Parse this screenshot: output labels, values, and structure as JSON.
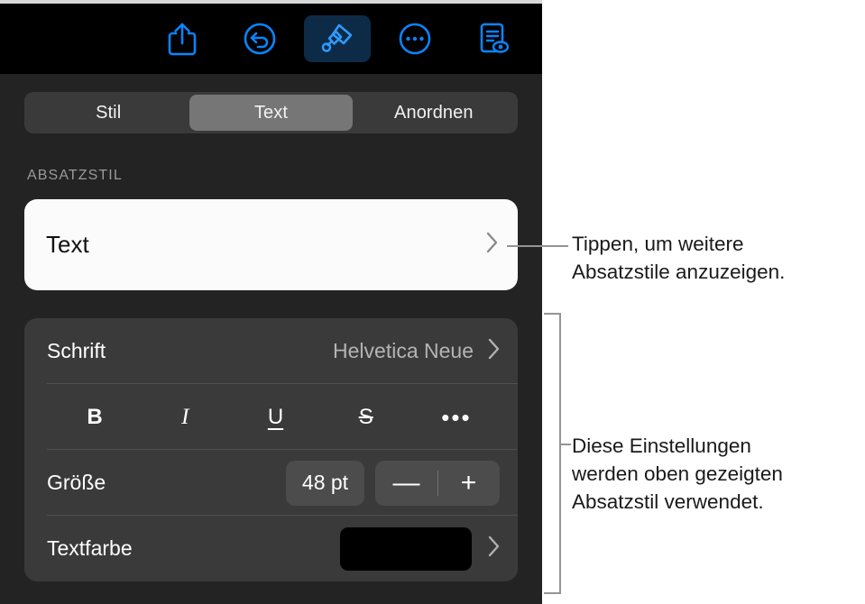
{
  "toolbar": {
    "buttons": [
      {
        "name": "share-icon",
        "label": "Teilen",
        "active": false
      },
      {
        "name": "undo-icon",
        "label": "Widerrufen",
        "active": false
      },
      {
        "name": "paintbrush-icon",
        "label": "Format",
        "active": true
      },
      {
        "name": "more-circle-icon",
        "label": "Mehr",
        "active": false
      },
      {
        "name": "document-view-icon",
        "label": "Dokument",
        "active": false
      }
    ]
  },
  "segmented": {
    "options": [
      "Stil",
      "Text",
      "Anordnen"
    ],
    "selected": "Text",
    "selected_index": 1
  },
  "paragraph_style": {
    "section_label": "ABSATZSTIL",
    "value": "Text",
    "chevron": "chevron-right-icon"
  },
  "settings": {
    "font": {
      "label": "Schrift",
      "value": "Helvetica Neue",
      "chevron": "chevron-right-icon"
    },
    "format": {
      "bold": "B",
      "italic": "I",
      "underline": "U",
      "strikethrough": "S",
      "more": "•••"
    },
    "size": {
      "label": "Größe",
      "value": "48 pt",
      "decrement": "—",
      "increment": "+"
    },
    "text_color": {
      "label": "Textfarbe",
      "swatch_color": "#000000",
      "chevron": "chevron-right-icon"
    }
  },
  "callouts": [
    {
      "id": "paragraph-style-callout",
      "text": "Tippen, um weitere\nAbsatzstile anzuzeigen."
    },
    {
      "id": "settings-callout",
      "text": "Diese Einstellungen\nwerden oben gezeigten\nAbsatzstil verwendet."
    }
  ],
  "colors": {
    "panel_background": "#232323",
    "toolbar_background": "#000000",
    "accent_blue": "#0a84ff",
    "active_tool_background": "#0d2b47",
    "card_background": "#3a3a3a",
    "segment_selected": "#767676",
    "white_card": "#fbfbfb",
    "callout_line": "#949494"
  }
}
